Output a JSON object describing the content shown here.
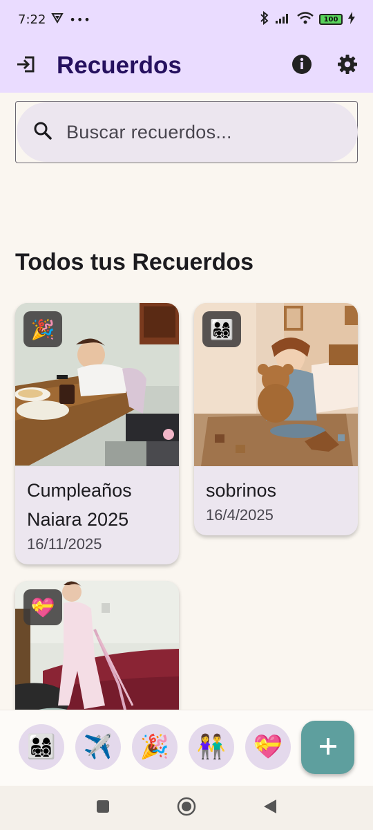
{
  "status": {
    "time": "7:22",
    "left_icons": [
      "vpn-icon",
      "more-icon"
    ],
    "right_icons": [
      "bluetooth-icon",
      "signal-icon",
      "wifi-icon",
      "battery-icon",
      "charging-icon"
    ],
    "battery": "100"
  },
  "app_bar": {
    "title": "Recuerdos",
    "login_icon": "login-icon",
    "info_icon": "info-icon",
    "settings_icon": "settings-icon"
  },
  "search": {
    "placeholder": "Buscar recuerdos...",
    "icon": "search-icon"
  },
  "section": {
    "title": "Todos tus Recuerdos"
  },
  "memories": [
    {
      "title": "Cumpleaños Naiara 2025",
      "date": "16/11/2025",
      "badge": "🎉",
      "badge_icon": "party-popper-icon"
    },
    {
      "title": "sobrinos",
      "date": "16/4/2025",
      "badge": "👨‍👩‍👧‍👦",
      "badge_icon": "family-icon"
    },
    {
      "title": "",
      "date": "",
      "badge": "💝",
      "badge_icon": "heart-gift-icon"
    }
  ],
  "categories": [
    {
      "emoji": "👨‍👩‍👧‍👦",
      "name": "family-icon"
    },
    {
      "emoji": "✈️",
      "name": "airplane-icon"
    },
    {
      "emoji": "🎉",
      "name": "party-popper-icon"
    },
    {
      "emoji": "👫",
      "name": "couple-icon"
    },
    {
      "emoji": "💝",
      "name": "heart-gift-icon"
    }
  ],
  "fab": {
    "icon": "plus-icon"
  },
  "colors": {
    "app_bar_bg": "#eadcff",
    "title": "#26115f",
    "fab": "#5e9f9e",
    "card_bg": "#ece6ef",
    "page_bg": "#faf6f0"
  }
}
